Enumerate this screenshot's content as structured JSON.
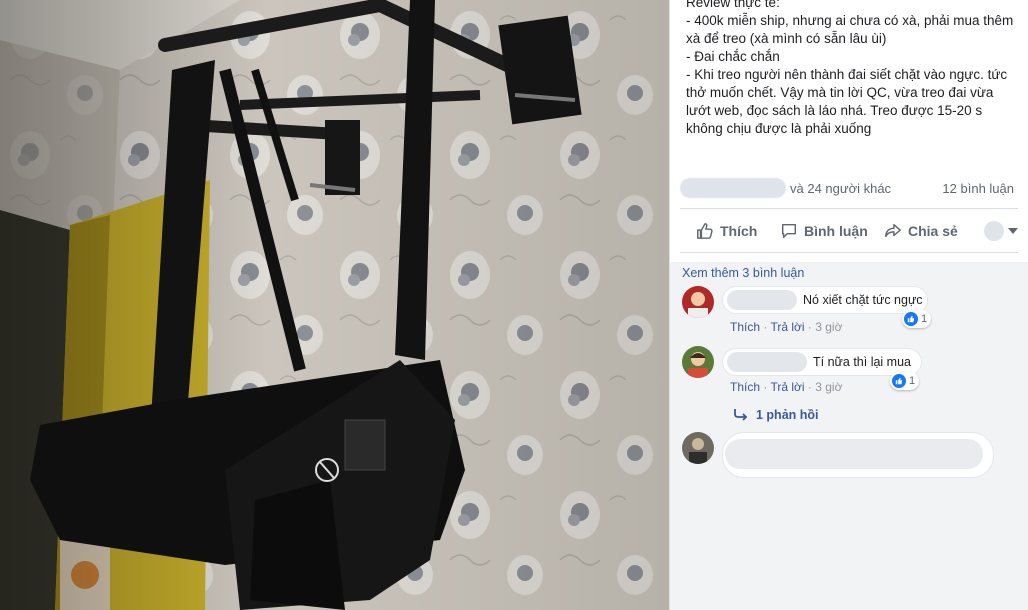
{
  "post": {
    "caption_lines": [
      "Review thực tế:",
      "- 400k miễn ship, nhưng ai chưa có xà, phải mua thêm xà để treo (xà mình có sẵn lâu ùi)",
      "- Đai chắc chắn",
      "- Khi treo người nên thành đai siết chặt vào ngực. tức thở muốn chết. Vậy mà tin lời QC, vừa treo đai vừa lướt web, đọc sách là láo nhá. Treo được 15-20 s không chịu được là phải xuống"
    ],
    "reactions_others": "và 24 người khác",
    "comment_count": "12 bình luận"
  },
  "actions": {
    "like": "Thích",
    "comment": "Bình luận",
    "share": "Chia sẻ"
  },
  "comments": {
    "view_more": "Xem thêm 3 bình luận",
    "items": [
      {
        "text": "Nó xiết chặt tức ngực",
        "like_label": "Thích",
        "reply_label": "Trả lời",
        "time": "3 giờ",
        "reactions": "1"
      },
      {
        "text": "Tí nữa thì lại mua",
        "like_label": "Thích",
        "reply_label": "Trả lời",
        "time": "3 giờ",
        "reactions": "1"
      }
    ],
    "replies": "1 phản hồi"
  },
  "colors": {
    "link": "#385898",
    "like_blue": "#1877f2",
    "secondary_text": "#606770",
    "comments_bg": "#f2f3f5"
  },
  "icons": [
    "like-icon",
    "comment-icon",
    "share-icon",
    "chevron-down-icon",
    "reply-arrow-icon"
  ]
}
